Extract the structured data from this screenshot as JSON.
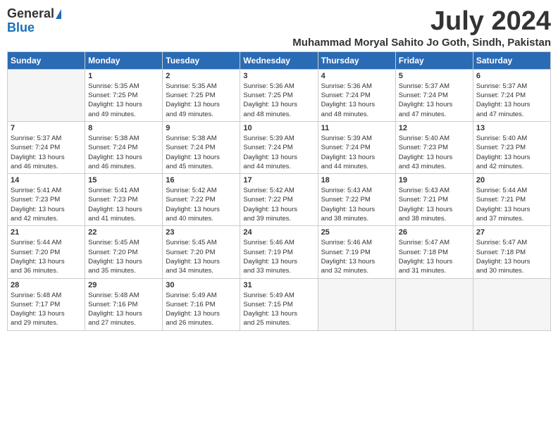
{
  "logo": {
    "general": "General",
    "blue": "Blue"
  },
  "title": "July 2024",
  "subtitle": "Muhammad Moryal Sahito Jo Goth, Sindh, Pakistan",
  "days_of_week": [
    "Sunday",
    "Monday",
    "Tuesday",
    "Wednesday",
    "Thursday",
    "Friday",
    "Saturday"
  ],
  "weeks": [
    [
      {
        "num": "",
        "info": ""
      },
      {
        "num": "1",
        "info": "Sunrise: 5:35 AM\nSunset: 7:25 PM\nDaylight: 13 hours\nand 49 minutes."
      },
      {
        "num": "2",
        "info": "Sunrise: 5:35 AM\nSunset: 7:25 PM\nDaylight: 13 hours\nand 49 minutes."
      },
      {
        "num": "3",
        "info": "Sunrise: 5:36 AM\nSunset: 7:25 PM\nDaylight: 13 hours\nand 48 minutes."
      },
      {
        "num": "4",
        "info": "Sunrise: 5:36 AM\nSunset: 7:24 PM\nDaylight: 13 hours\nand 48 minutes."
      },
      {
        "num": "5",
        "info": "Sunrise: 5:37 AM\nSunset: 7:24 PM\nDaylight: 13 hours\nand 47 minutes."
      },
      {
        "num": "6",
        "info": "Sunrise: 5:37 AM\nSunset: 7:24 PM\nDaylight: 13 hours\nand 47 minutes."
      }
    ],
    [
      {
        "num": "7",
        "info": "Sunrise: 5:37 AM\nSunset: 7:24 PM\nDaylight: 13 hours\nand 46 minutes."
      },
      {
        "num": "8",
        "info": "Sunrise: 5:38 AM\nSunset: 7:24 PM\nDaylight: 13 hours\nand 46 minutes."
      },
      {
        "num": "9",
        "info": "Sunrise: 5:38 AM\nSunset: 7:24 PM\nDaylight: 13 hours\nand 45 minutes."
      },
      {
        "num": "10",
        "info": "Sunrise: 5:39 AM\nSunset: 7:24 PM\nDaylight: 13 hours\nand 44 minutes."
      },
      {
        "num": "11",
        "info": "Sunrise: 5:39 AM\nSunset: 7:24 PM\nDaylight: 13 hours\nand 44 minutes."
      },
      {
        "num": "12",
        "info": "Sunrise: 5:40 AM\nSunset: 7:23 PM\nDaylight: 13 hours\nand 43 minutes."
      },
      {
        "num": "13",
        "info": "Sunrise: 5:40 AM\nSunset: 7:23 PM\nDaylight: 13 hours\nand 42 minutes."
      }
    ],
    [
      {
        "num": "14",
        "info": "Sunrise: 5:41 AM\nSunset: 7:23 PM\nDaylight: 13 hours\nand 42 minutes."
      },
      {
        "num": "15",
        "info": "Sunrise: 5:41 AM\nSunset: 7:23 PM\nDaylight: 13 hours\nand 41 minutes."
      },
      {
        "num": "16",
        "info": "Sunrise: 5:42 AM\nSunset: 7:22 PM\nDaylight: 13 hours\nand 40 minutes."
      },
      {
        "num": "17",
        "info": "Sunrise: 5:42 AM\nSunset: 7:22 PM\nDaylight: 13 hours\nand 39 minutes."
      },
      {
        "num": "18",
        "info": "Sunrise: 5:43 AM\nSunset: 7:22 PM\nDaylight: 13 hours\nand 38 minutes."
      },
      {
        "num": "19",
        "info": "Sunrise: 5:43 AM\nSunset: 7:21 PM\nDaylight: 13 hours\nand 38 minutes."
      },
      {
        "num": "20",
        "info": "Sunrise: 5:44 AM\nSunset: 7:21 PM\nDaylight: 13 hours\nand 37 minutes."
      }
    ],
    [
      {
        "num": "21",
        "info": "Sunrise: 5:44 AM\nSunset: 7:20 PM\nDaylight: 13 hours\nand 36 minutes."
      },
      {
        "num": "22",
        "info": "Sunrise: 5:45 AM\nSunset: 7:20 PM\nDaylight: 13 hours\nand 35 minutes."
      },
      {
        "num": "23",
        "info": "Sunrise: 5:45 AM\nSunset: 7:20 PM\nDaylight: 13 hours\nand 34 minutes."
      },
      {
        "num": "24",
        "info": "Sunrise: 5:46 AM\nSunset: 7:19 PM\nDaylight: 13 hours\nand 33 minutes."
      },
      {
        "num": "25",
        "info": "Sunrise: 5:46 AM\nSunset: 7:19 PM\nDaylight: 13 hours\nand 32 minutes."
      },
      {
        "num": "26",
        "info": "Sunrise: 5:47 AM\nSunset: 7:18 PM\nDaylight: 13 hours\nand 31 minutes."
      },
      {
        "num": "27",
        "info": "Sunrise: 5:47 AM\nSunset: 7:18 PM\nDaylight: 13 hours\nand 30 minutes."
      }
    ],
    [
      {
        "num": "28",
        "info": "Sunrise: 5:48 AM\nSunset: 7:17 PM\nDaylight: 13 hours\nand 29 minutes."
      },
      {
        "num": "29",
        "info": "Sunrise: 5:48 AM\nSunset: 7:16 PM\nDaylight: 13 hours\nand 27 minutes."
      },
      {
        "num": "30",
        "info": "Sunrise: 5:49 AM\nSunset: 7:16 PM\nDaylight: 13 hours\nand 26 minutes."
      },
      {
        "num": "31",
        "info": "Sunrise: 5:49 AM\nSunset: 7:15 PM\nDaylight: 13 hours\nand 25 minutes."
      },
      {
        "num": "",
        "info": ""
      },
      {
        "num": "",
        "info": ""
      },
      {
        "num": "",
        "info": ""
      }
    ]
  ]
}
